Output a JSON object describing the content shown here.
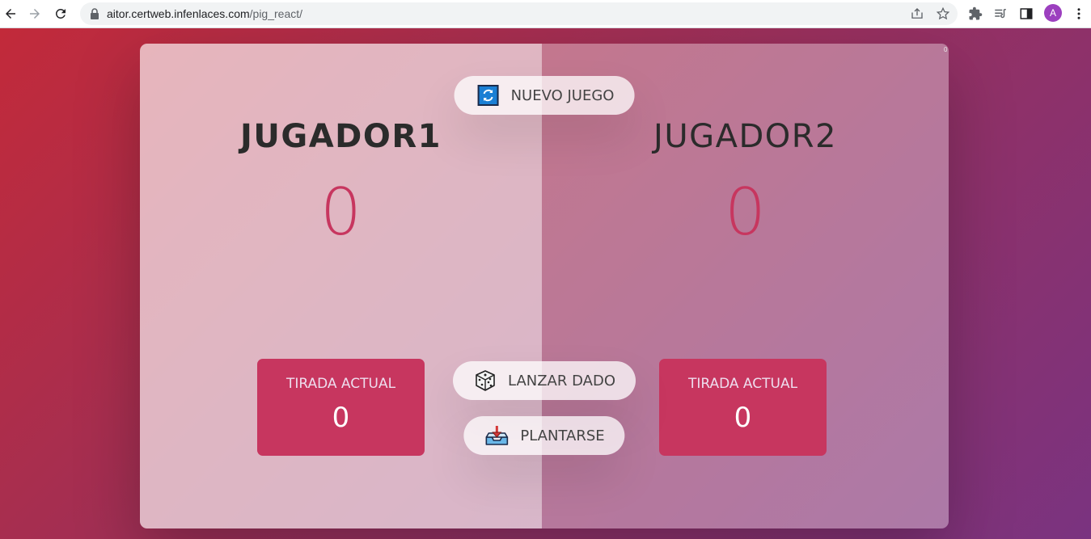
{
  "browser": {
    "url_host": "aitor.certweb.infenlaces.com",
    "url_path": "/pig_react/",
    "avatar_letter": "A",
    "accent": "#9c3fbf"
  },
  "game": {
    "new_game_label": "NUEVO JUEGO",
    "roll_label": "LANZAR DADO",
    "hold_label": "PLANTARSE",
    "players": [
      {
        "name": "JUGADOR1",
        "score": "0",
        "current_label": "TIRADA ACTUAL",
        "current_score": "0",
        "active": true
      },
      {
        "name": "JUGADOR2",
        "score": "0",
        "current_label": "TIRADA ACTUAL",
        "current_score": "0",
        "active": false
      }
    ],
    "corner_text": "0",
    "colors": {
      "accent": "#c7365f",
      "bg_start": "#c22a3a",
      "bg_end": "#7a3380"
    }
  }
}
